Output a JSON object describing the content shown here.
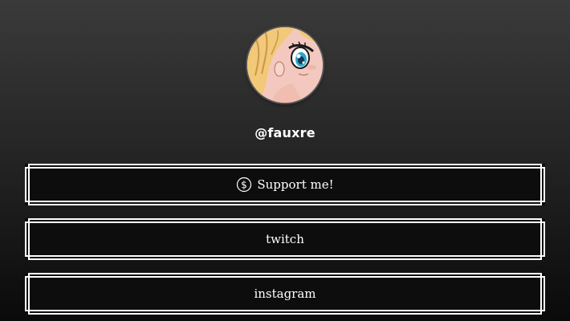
{
  "profile": {
    "handle": "@fauxre",
    "avatar_icon": "anime-girl-avatar"
  },
  "links": [
    {
      "label": "Support me!",
      "icon": "dollar-circle-icon"
    },
    {
      "label": "twitch"
    },
    {
      "label": "instagram"
    }
  ],
  "colors": {
    "background_top": "#3a3a3a",
    "background_bottom": "#0a0a0a",
    "button_border": "#ffffff",
    "text": "#ffffff"
  }
}
